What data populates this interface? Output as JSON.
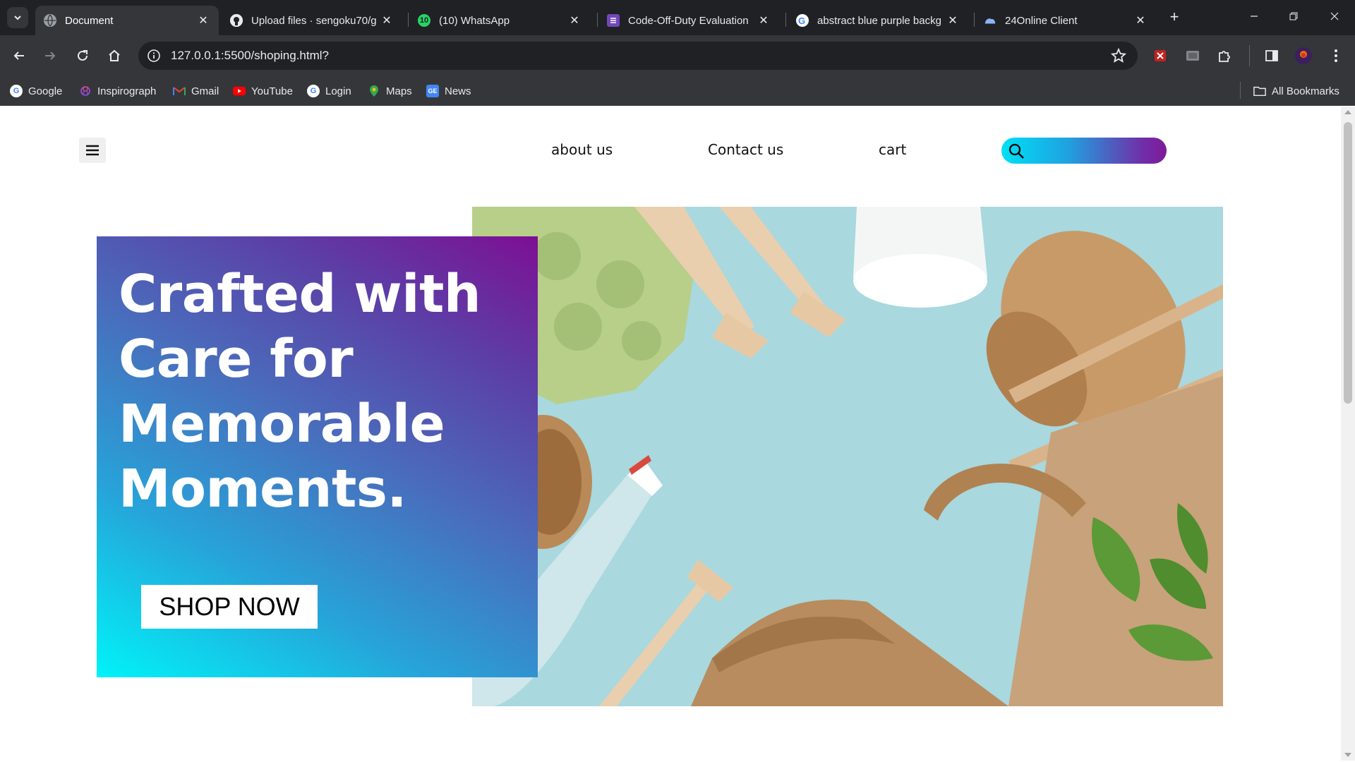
{
  "browser": {
    "tabs": [
      {
        "title": "Document",
        "icon": "globe-icon",
        "active": true
      },
      {
        "title": "Upload files · sengoku70/g",
        "icon": "github-icon"
      },
      {
        "title": "(10) WhatsApp",
        "icon": "whatsapp-icon",
        "badge": "10"
      },
      {
        "title": "Code-Off-Duty Evaluation",
        "icon": "forms-icon"
      },
      {
        "title": "abstract blue purple backg",
        "icon": "google-icon"
      },
      {
        "title": "24Online Client",
        "icon": "cloud-icon"
      }
    ],
    "url": "127.0.0.1:5500/shoping.html?",
    "bookmarks": [
      {
        "label": "Google",
        "icon": "google-icon"
      },
      {
        "label": "Inspirograph",
        "icon": "spirograph-icon"
      },
      {
        "label": "Gmail",
        "icon": "gmail-icon"
      },
      {
        "label": "YouTube",
        "icon": "youtube-icon"
      },
      {
        "label": "Login",
        "icon": "google-icon"
      },
      {
        "label": "Maps",
        "icon": "maps-icon"
      },
      {
        "label": "News",
        "icon": "news-icon"
      }
    ],
    "all_bookmarks": "All Bookmarks"
  },
  "page": {
    "nav": {
      "about": "about us",
      "contact": "Contact us",
      "cart": "cart"
    },
    "hero": {
      "title": "Crafted with Care for Memorable Moments.",
      "cta": "SHOP NOW"
    }
  },
  "colors": {
    "chrome_dark": "#202124",
    "chrome_toolbar": "#35363a",
    "gradient_cyan": "#00f3f8",
    "gradient_purple": "#7d0f94",
    "photo_background": "#a9d8df"
  }
}
